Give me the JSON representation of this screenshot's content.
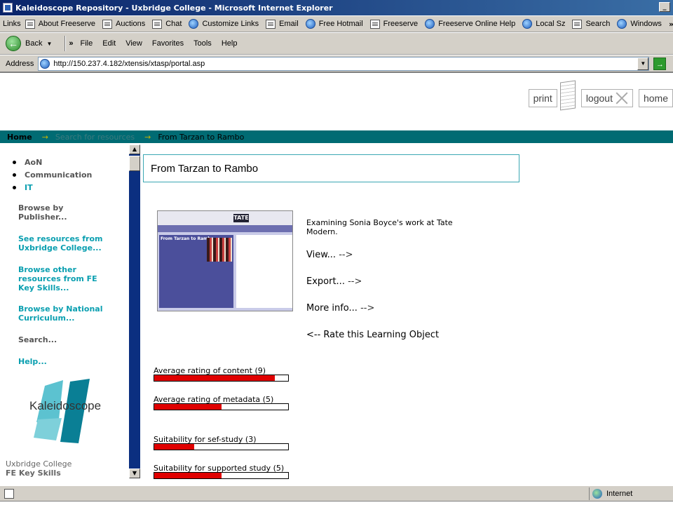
{
  "window": {
    "title": "Kaleidoscope Repository - Uxbridge College - Microsoft Internet Explorer"
  },
  "links_bar": {
    "label": "Links",
    "items": [
      "About Freeserve",
      "Auctions",
      "Chat",
      "Customize Links",
      "Email",
      "Free Hotmail",
      "Freeserve",
      "Freeserve Online Help",
      "Local Sz",
      "Search",
      "Windows"
    ],
    "icons": [
      "page-icon",
      "page-icon",
      "page-icon",
      "ie-icon",
      "page-icon",
      "ie-icon",
      "page-icon",
      "ie-icon",
      "ie-icon",
      "page-icon",
      "ie-icon"
    ]
  },
  "menu_bar": {
    "back_label": "Back",
    "items": [
      "File",
      "Edit",
      "View",
      "Favorites",
      "Tools",
      "Help"
    ]
  },
  "address_bar": {
    "label": "Address",
    "url": "http://150.237.4.182/xtensis/xtasp/portal.asp"
  },
  "header": {
    "print": "print",
    "logout": "logout",
    "home": "home"
  },
  "breadcrumb": {
    "home": "Home",
    "arrow": "→",
    "search": "Search for resources",
    "current": "From Tarzan to Rambo"
  },
  "left_nav": {
    "bullets": [
      "AoN",
      "Communication",
      "IT"
    ],
    "browse_publisher": "Browse by Publisher...",
    "see_resources": "See resources from Uxbridge College...",
    "browse_other": "Browse other resources from FE Key Skills...",
    "browse_national": "Browse by National Curriculum...",
    "search": "Search...",
    "help": "Help...",
    "logo_text": "Kaleidoscope",
    "footer_college": "Uxbridge College",
    "footer_skills": "FE Key Skills"
  },
  "main": {
    "title": "From Tarzan to Rambo",
    "thumbnail_title": "From Tarzan to Rambo",
    "thumbnail_brand": "TATE",
    "description": "Examining Sonia Boyce's work at Tate Modern.",
    "view": "View...",
    "export": "Export...",
    "more_info": "More info...",
    "arrow_right": "-->",
    "rate": "<-- Rate this Learning Object"
  },
  "ratings": [
    {
      "label": "Average rating of content (9)",
      "fraction": 0.9
    },
    {
      "label": "Average rating of metadata (5)",
      "fraction": 0.5
    },
    {
      "label": "Suitability for sef-study (3)",
      "fraction": 0.3
    },
    {
      "label": "Suitability for supported study (5)",
      "fraction": 0.5
    }
  ],
  "status_bar": {
    "zone": "Internet"
  },
  "colors": {
    "breadcrumb_bar": "#006b73",
    "teal_link": "#0a9fb0",
    "rating_fill": "#e00000",
    "scrollbar_track": "#0b2f80"
  }
}
